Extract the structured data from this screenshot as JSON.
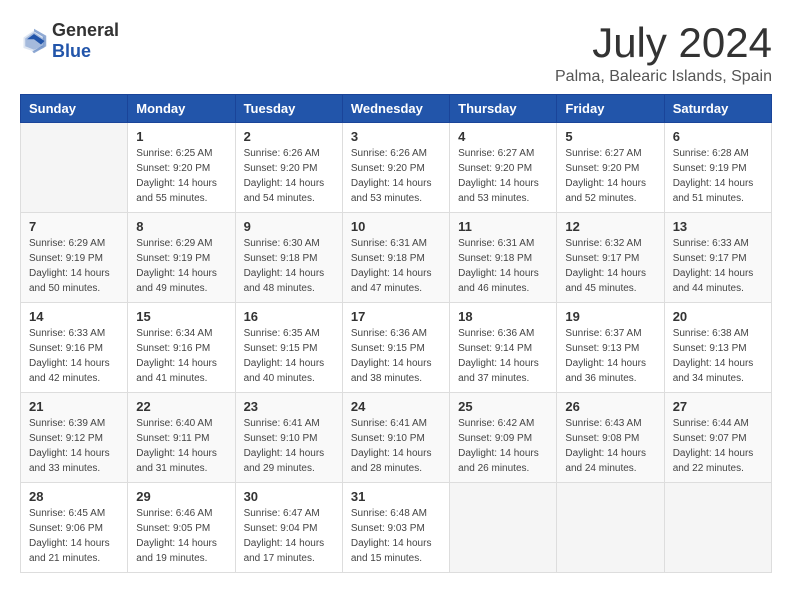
{
  "header": {
    "logo_general": "General",
    "logo_blue": "Blue",
    "month": "July 2024",
    "location": "Palma, Balearic Islands, Spain"
  },
  "weekdays": [
    "Sunday",
    "Monday",
    "Tuesday",
    "Wednesday",
    "Thursday",
    "Friday",
    "Saturday"
  ],
  "weeks": [
    [
      {
        "day": "",
        "sunrise": "",
        "sunset": "",
        "daylight": ""
      },
      {
        "day": "1",
        "sunrise": "Sunrise: 6:25 AM",
        "sunset": "Sunset: 9:20 PM",
        "daylight": "Daylight: 14 hours and 55 minutes."
      },
      {
        "day": "2",
        "sunrise": "Sunrise: 6:26 AM",
        "sunset": "Sunset: 9:20 PM",
        "daylight": "Daylight: 14 hours and 54 minutes."
      },
      {
        "day": "3",
        "sunrise": "Sunrise: 6:26 AM",
        "sunset": "Sunset: 9:20 PM",
        "daylight": "Daylight: 14 hours and 53 minutes."
      },
      {
        "day": "4",
        "sunrise": "Sunrise: 6:27 AM",
        "sunset": "Sunset: 9:20 PM",
        "daylight": "Daylight: 14 hours and 53 minutes."
      },
      {
        "day": "5",
        "sunrise": "Sunrise: 6:27 AM",
        "sunset": "Sunset: 9:20 PM",
        "daylight": "Daylight: 14 hours and 52 minutes."
      },
      {
        "day": "6",
        "sunrise": "Sunrise: 6:28 AM",
        "sunset": "Sunset: 9:19 PM",
        "daylight": "Daylight: 14 hours and 51 minutes."
      }
    ],
    [
      {
        "day": "7",
        "sunrise": "Sunrise: 6:29 AM",
        "sunset": "Sunset: 9:19 PM",
        "daylight": "Daylight: 14 hours and 50 minutes."
      },
      {
        "day": "8",
        "sunrise": "Sunrise: 6:29 AM",
        "sunset": "Sunset: 9:19 PM",
        "daylight": "Daylight: 14 hours and 49 minutes."
      },
      {
        "day": "9",
        "sunrise": "Sunrise: 6:30 AM",
        "sunset": "Sunset: 9:18 PM",
        "daylight": "Daylight: 14 hours and 48 minutes."
      },
      {
        "day": "10",
        "sunrise": "Sunrise: 6:31 AM",
        "sunset": "Sunset: 9:18 PM",
        "daylight": "Daylight: 14 hours and 47 minutes."
      },
      {
        "day": "11",
        "sunrise": "Sunrise: 6:31 AM",
        "sunset": "Sunset: 9:18 PM",
        "daylight": "Daylight: 14 hours and 46 minutes."
      },
      {
        "day": "12",
        "sunrise": "Sunrise: 6:32 AM",
        "sunset": "Sunset: 9:17 PM",
        "daylight": "Daylight: 14 hours and 45 minutes."
      },
      {
        "day": "13",
        "sunrise": "Sunrise: 6:33 AM",
        "sunset": "Sunset: 9:17 PM",
        "daylight": "Daylight: 14 hours and 44 minutes."
      }
    ],
    [
      {
        "day": "14",
        "sunrise": "Sunrise: 6:33 AM",
        "sunset": "Sunset: 9:16 PM",
        "daylight": "Daylight: 14 hours and 42 minutes."
      },
      {
        "day": "15",
        "sunrise": "Sunrise: 6:34 AM",
        "sunset": "Sunset: 9:16 PM",
        "daylight": "Daylight: 14 hours and 41 minutes."
      },
      {
        "day": "16",
        "sunrise": "Sunrise: 6:35 AM",
        "sunset": "Sunset: 9:15 PM",
        "daylight": "Daylight: 14 hours and 40 minutes."
      },
      {
        "day": "17",
        "sunrise": "Sunrise: 6:36 AM",
        "sunset": "Sunset: 9:15 PM",
        "daylight": "Daylight: 14 hours and 38 minutes."
      },
      {
        "day": "18",
        "sunrise": "Sunrise: 6:36 AM",
        "sunset": "Sunset: 9:14 PM",
        "daylight": "Daylight: 14 hours and 37 minutes."
      },
      {
        "day": "19",
        "sunrise": "Sunrise: 6:37 AM",
        "sunset": "Sunset: 9:13 PM",
        "daylight": "Daylight: 14 hours and 36 minutes."
      },
      {
        "day": "20",
        "sunrise": "Sunrise: 6:38 AM",
        "sunset": "Sunset: 9:13 PM",
        "daylight": "Daylight: 14 hours and 34 minutes."
      }
    ],
    [
      {
        "day": "21",
        "sunrise": "Sunrise: 6:39 AM",
        "sunset": "Sunset: 9:12 PM",
        "daylight": "Daylight: 14 hours and 33 minutes."
      },
      {
        "day": "22",
        "sunrise": "Sunrise: 6:40 AM",
        "sunset": "Sunset: 9:11 PM",
        "daylight": "Daylight: 14 hours and 31 minutes."
      },
      {
        "day": "23",
        "sunrise": "Sunrise: 6:41 AM",
        "sunset": "Sunset: 9:10 PM",
        "daylight": "Daylight: 14 hours and 29 minutes."
      },
      {
        "day": "24",
        "sunrise": "Sunrise: 6:41 AM",
        "sunset": "Sunset: 9:10 PM",
        "daylight": "Daylight: 14 hours and 28 minutes."
      },
      {
        "day": "25",
        "sunrise": "Sunrise: 6:42 AM",
        "sunset": "Sunset: 9:09 PM",
        "daylight": "Daylight: 14 hours and 26 minutes."
      },
      {
        "day": "26",
        "sunrise": "Sunrise: 6:43 AM",
        "sunset": "Sunset: 9:08 PM",
        "daylight": "Daylight: 14 hours and 24 minutes."
      },
      {
        "day": "27",
        "sunrise": "Sunrise: 6:44 AM",
        "sunset": "Sunset: 9:07 PM",
        "daylight": "Daylight: 14 hours and 22 minutes."
      }
    ],
    [
      {
        "day": "28",
        "sunrise": "Sunrise: 6:45 AM",
        "sunset": "Sunset: 9:06 PM",
        "daylight": "Daylight: 14 hours and 21 minutes."
      },
      {
        "day": "29",
        "sunrise": "Sunrise: 6:46 AM",
        "sunset": "Sunset: 9:05 PM",
        "daylight": "Daylight: 14 hours and 19 minutes."
      },
      {
        "day": "30",
        "sunrise": "Sunrise: 6:47 AM",
        "sunset": "Sunset: 9:04 PM",
        "daylight": "Daylight: 14 hours and 17 minutes."
      },
      {
        "day": "31",
        "sunrise": "Sunrise: 6:48 AM",
        "sunset": "Sunset: 9:03 PM",
        "daylight": "Daylight: 14 hours and 15 minutes."
      },
      {
        "day": "",
        "sunrise": "",
        "sunset": "",
        "daylight": ""
      },
      {
        "day": "",
        "sunrise": "",
        "sunset": "",
        "daylight": ""
      },
      {
        "day": "",
        "sunrise": "",
        "sunset": "",
        "daylight": ""
      }
    ]
  ]
}
